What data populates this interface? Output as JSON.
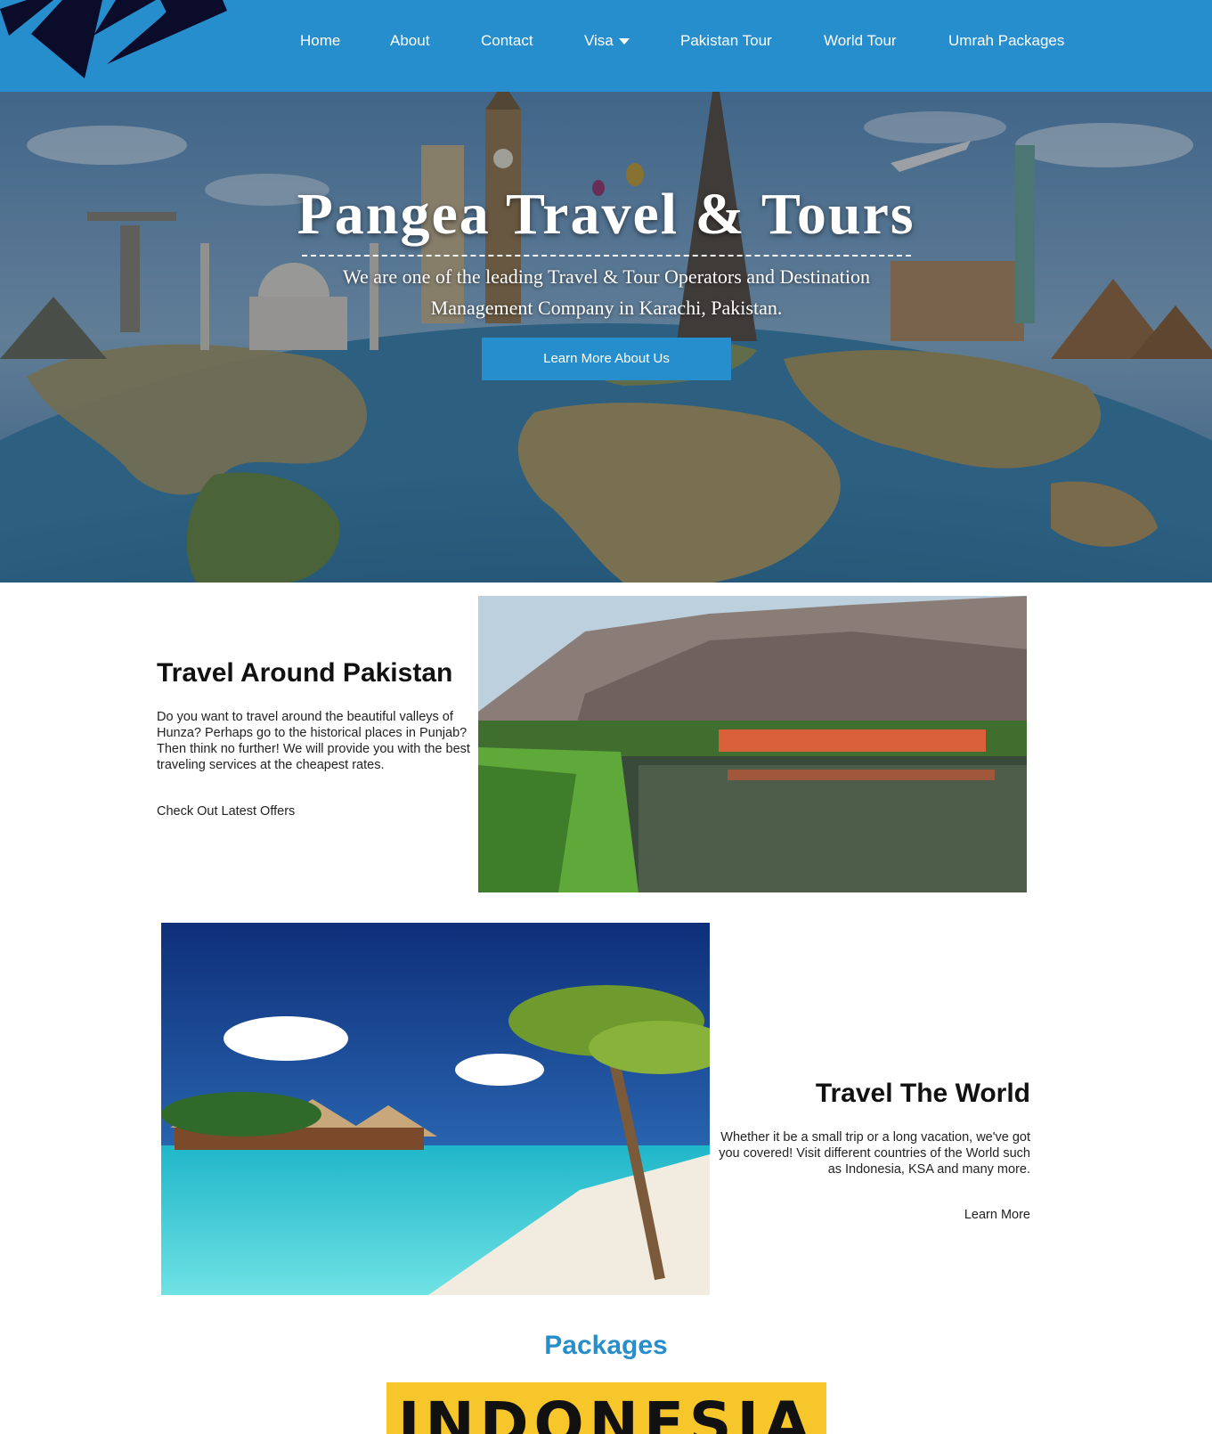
{
  "nav": {
    "items": [
      {
        "label": "Home"
      },
      {
        "label": "About"
      },
      {
        "label": "Contact"
      },
      {
        "label": "Visa"
      },
      {
        "label": "Pakistan Tour"
      },
      {
        "label": "World Tour"
      },
      {
        "label": "Umrah Packages"
      }
    ]
  },
  "hero": {
    "title": "Pangea Travel & Tours",
    "subtitle": "We are one of the leading Travel & Tour Operators and Destination Management Company in Karachi, Pakistan.",
    "button": "Learn More About Us"
  },
  "pakistan": {
    "title": "Travel Around Pakistan",
    "text": "Do you want to travel around the beautiful valleys of Hunza? Perhaps go to the historical places in Punjab? Then think no further! We will provide you with the best traveling services at the cheapest rates.",
    "link": "Check Out Latest Offers"
  },
  "world": {
    "title": "Travel The World",
    "text": "Whether it be a small trip or a long vacation, we've got you covered! Visit different countries of the World such as Indonesia, KSA and many more.",
    "link": "Learn More"
  },
  "packages": {
    "title": "Packages",
    "banner": "INDONESIA"
  },
  "colors": {
    "brand": "#278ecd",
    "banner": "#f7c62a"
  }
}
